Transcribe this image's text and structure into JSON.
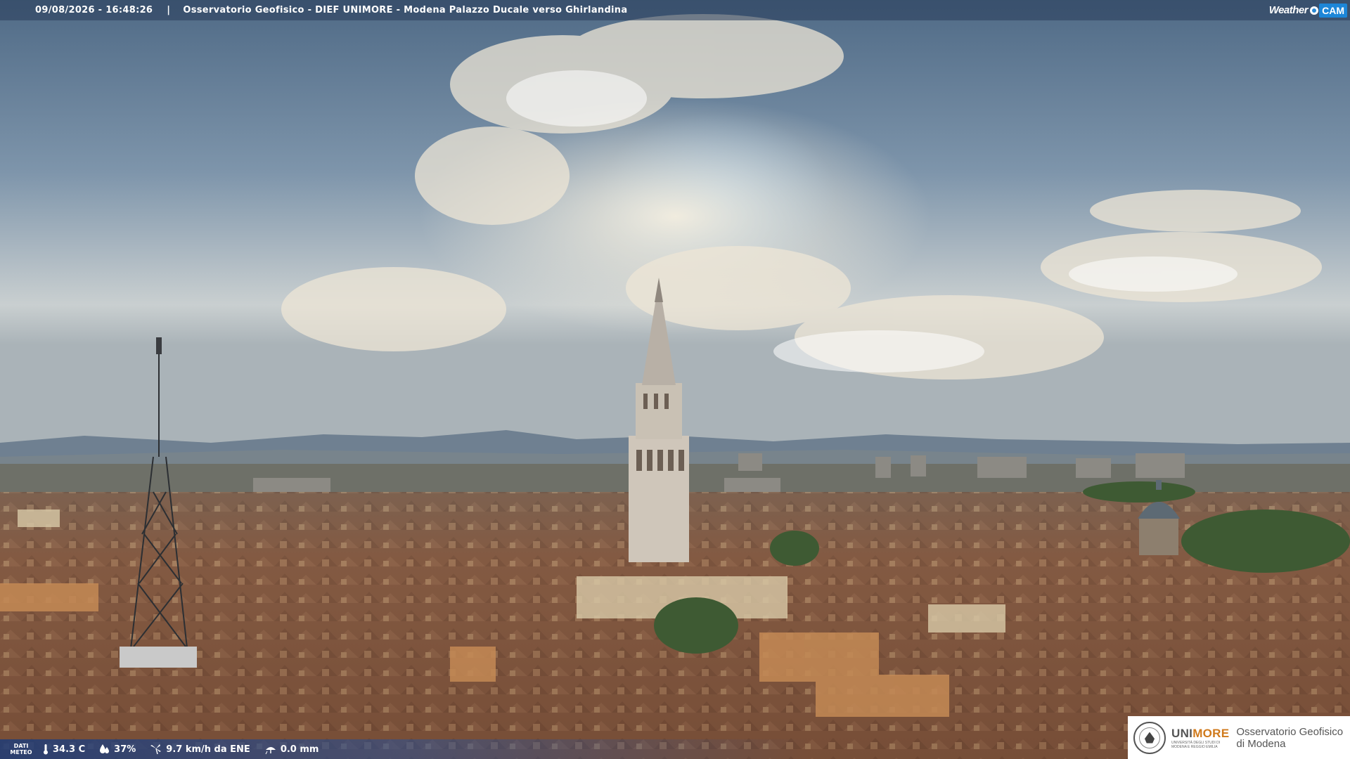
{
  "header": {
    "timestamp": "09/08/2026 - 16:48:26",
    "separator": "|",
    "title": "Osservatorio Geofisico - DIEF UNIMORE - Modena Palazzo Ducale verso Ghirlandina"
  },
  "brand": {
    "weather": "Weather",
    "cam": "CAM"
  },
  "weather_bar": {
    "label_line1": "DATI",
    "label_line2": "METEO",
    "temperature": "34.3 C",
    "humidity": "37%",
    "wind": "9.7 km/h da ENE",
    "rain": "0.0 mm"
  },
  "logo": {
    "uni_part1": "UNI",
    "uni_part2": "MORE",
    "uni_sub1": "UNIVERSITÀ DEGLI STUDI DI",
    "uni_sub2": "MODENA E REGGIO EMILIA",
    "observatory_line1": "Osservatorio Geofisico",
    "observatory_line2": "di Modena"
  },
  "colors": {
    "accent_blue": "#1d86d8",
    "unimore_orange": "#d07a1c"
  }
}
